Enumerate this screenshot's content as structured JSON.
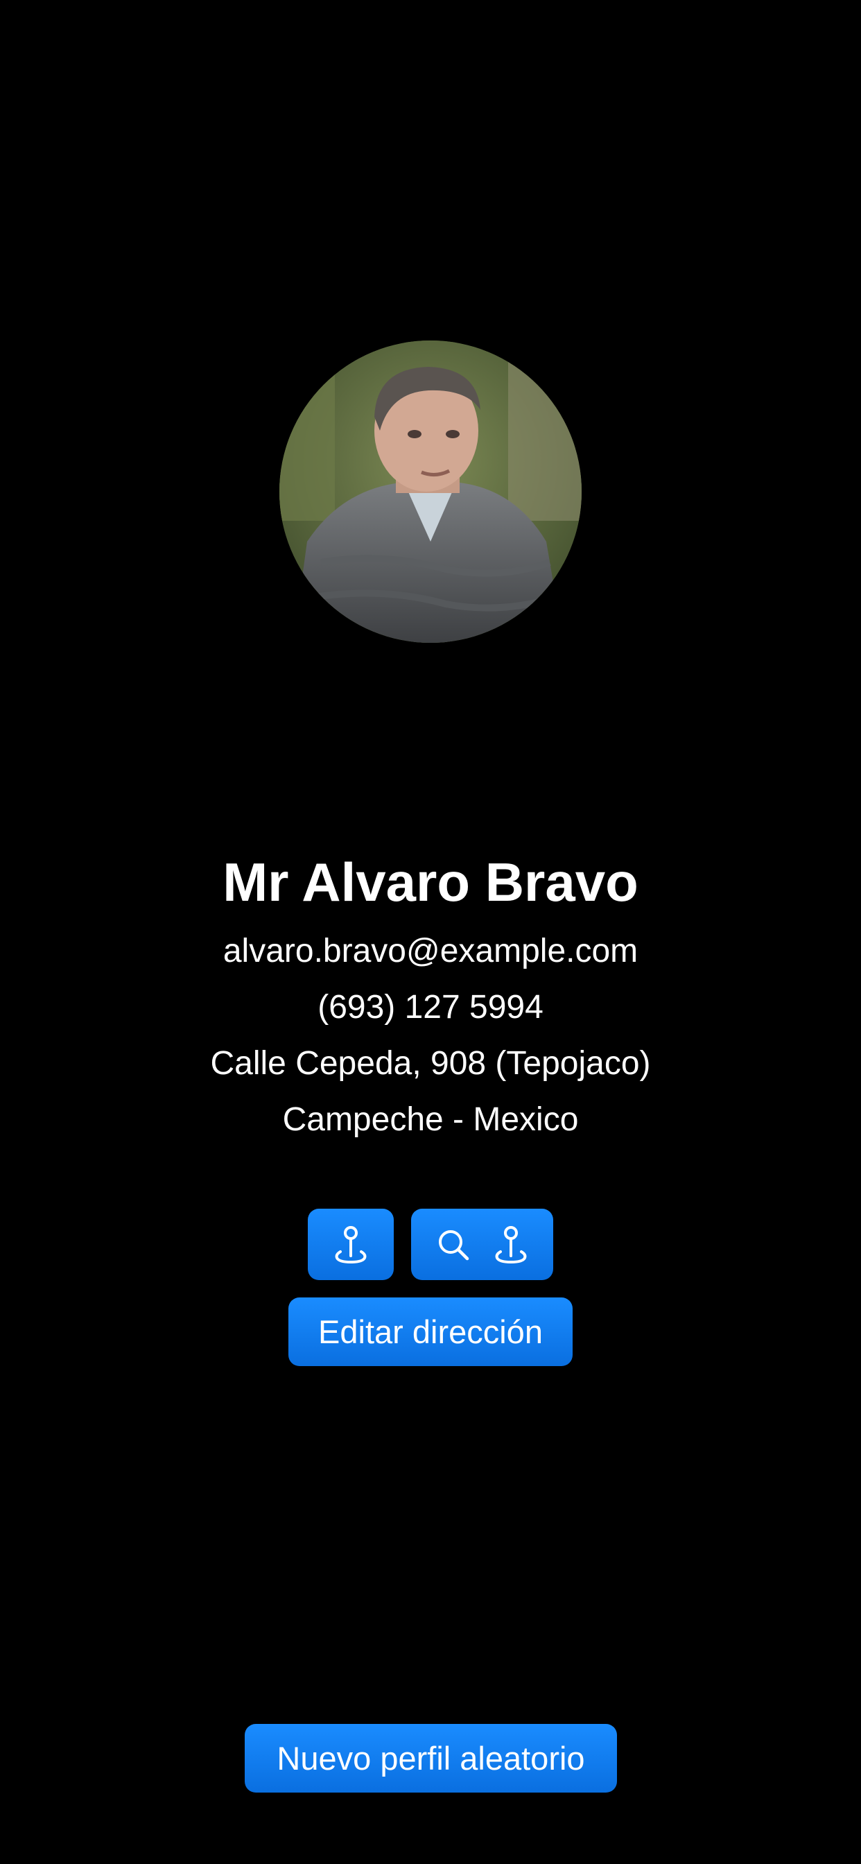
{
  "profile": {
    "name": "Mr Alvaro Bravo",
    "email": "alvaro.bravo@example.com",
    "phone": "(693) 127 5994",
    "street": "Calle Cepeda, 908 (Tepojaco)",
    "city_country": "Campeche - Mexico",
    "avatar_icon": "person-photo"
  },
  "actions": {
    "map_button_icon": "map-pin-icon",
    "search_map_button_icons": [
      "search-icon",
      "map-pin-icon"
    ],
    "edit_address_label": "Editar dirección",
    "new_random_profile_label": "Nuevo perfil aleatorio"
  },
  "colors": {
    "background": "#000000",
    "text": "#ffffff",
    "accent": "#0A84FF"
  }
}
